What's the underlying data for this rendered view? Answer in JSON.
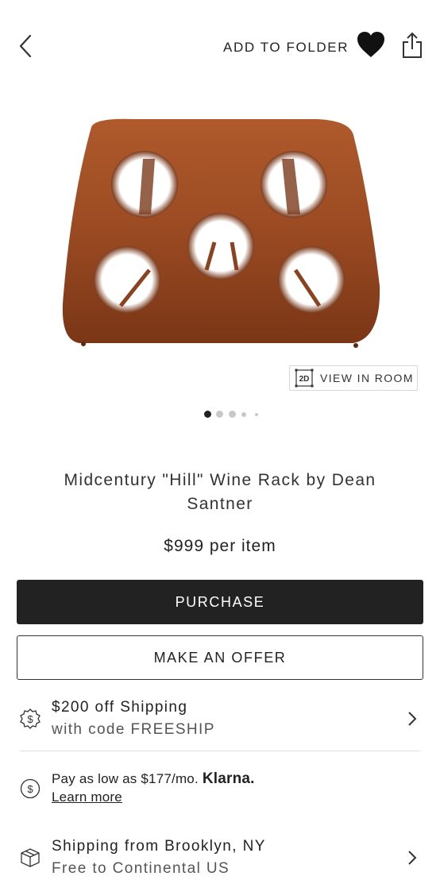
{
  "header": {
    "add_to_folder_label": "ADD TO FOLDER"
  },
  "gallery": {
    "view_in_room_badge": "2D",
    "view_in_room_label": "VIEW IN ROOM",
    "slide_count": 5,
    "active_slide": 1
  },
  "product": {
    "title": "Midcentury \"Hill\" Wine Rack by Dean Santner",
    "price": "$999 per item"
  },
  "actions": {
    "purchase_label": "PURCHASE",
    "offer_label": "MAKE AN OFFER"
  },
  "promo": {
    "title": "$200 off Shipping",
    "subtitle": "with code FREESHIP"
  },
  "financing": {
    "text": "Pay as low as $177/mo.",
    "brand": "Klarna.",
    "learn_more": "Learn more"
  },
  "shipping": {
    "title": "Shipping from Brooklyn, NY",
    "subtitle": "Free to Continental US"
  },
  "colors": {
    "primary_button": "#222222",
    "wood": "#9a4a22"
  }
}
